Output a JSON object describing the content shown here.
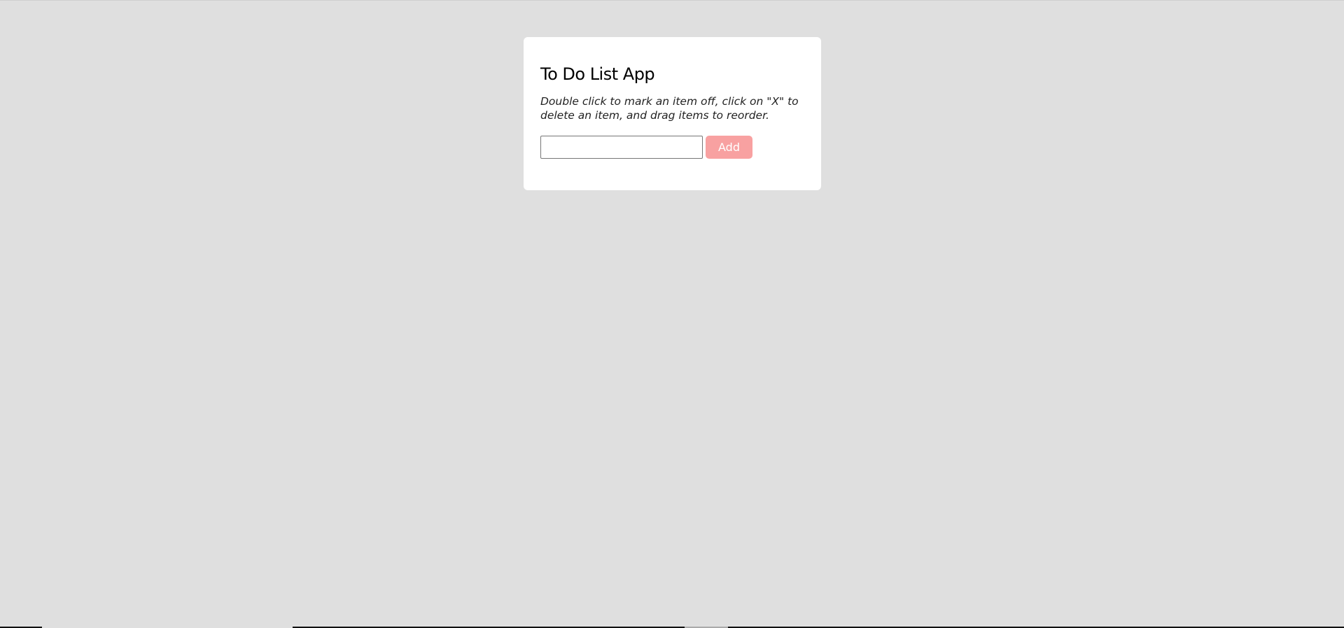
{
  "app": {
    "title": "To Do List App",
    "instructions": "Double click to mark an item off, click on \"X\" to delete an item, and drag items to reorder."
  },
  "form": {
    "input_value": "",
    "input_placeholder": "",
    "add_label": "Add"
  },
  "colors": {
    "background": "#dfdfdf",
    "card": "#ffffff",
    "accent": "#f8a1a1"
  },
  "todo_items": []
}
